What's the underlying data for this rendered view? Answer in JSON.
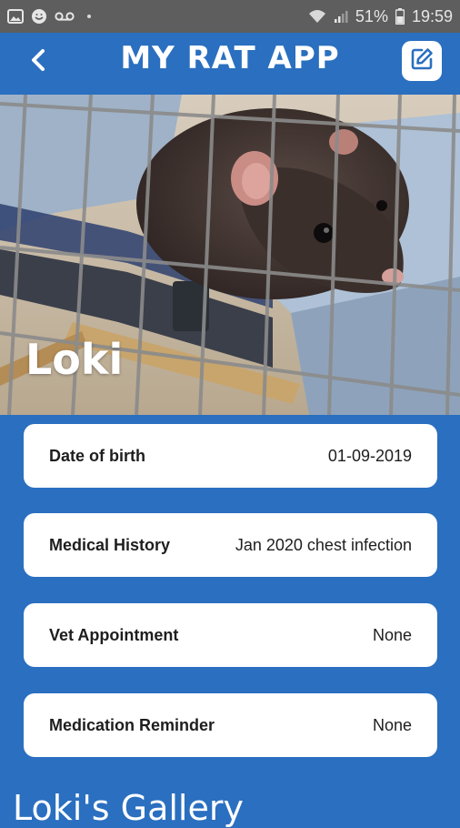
{
  "status_bar": {
    "battery_percent": "51%",
    "time": "19:59",
    "left_icons": [
      "image-icon",
      "smiley-icon",
      "voicemail-icon"
    ],
    "right_icons": [
      "wifi-icon",
      "signal-icon",
      "battery-icon"
    ]
  },
  "header": {
    "title": "MY RAT APP",
    "back_icon": "chevron-left-icon",
    "edit_icon": "edit-icon"
  },
  "pet": {
    "name": "Loki"
  },
  "details": [
    {
      "label": "Date of birth",
      "value": "01-09-2019"
    },
    {
      "label": "Medical History",
      "value": "Jan 2020 chest infection"
    },
    {
      "label": "Vet Appointment",
      "value": "None"
    },
    {
      "label": "Medication Reminder",
      "value": "None"
    }
  ],
  "gallery": {
    "title": "Loki's Gallery"
  },
  "colors": {
    "primary": "#2a6fc0",
    "status_bar": "#5e5e5e",
    "card": "#ffffff"
  }
}
